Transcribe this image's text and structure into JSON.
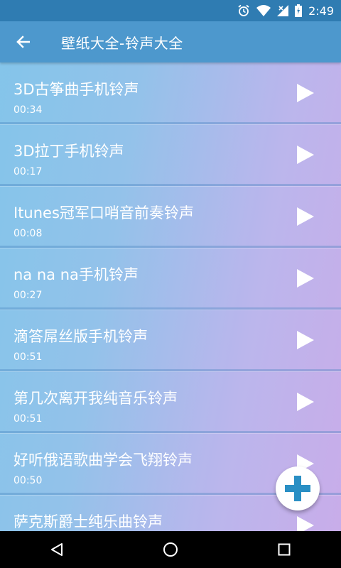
{
  "status_bar": {
    "time": "2:49",
    "icons": [
      "alarm-icon",
      "wifi-icon",
      "signal-icon",
      "battery-icon"
    ]
  },
  "app_bar": {
    "title": "壁纸大全-铃声大全",
    "back_icon": "arrow-left-icon"
  },
  "ringtones": [
    {
      "title": "3D古筝曲手机铃声",
      "duration": "00:34"
    },
    {
      "title": "3D拉丁手机铃声",
      "duration": "00:17"
    },
    {
      "title": "Itunes冠军口哨音前奏铃声",
      "duration": "00:08"
    },
    {
      "title": "na na na手机铃声",
      "duration": "00:27"
    },
    {
      "title": "滴答屌丝版手机铃声",
      "duration": "00:51"
    },
    {
      "title": "第几次离开我纯音乐铃声",
      "duration": "00:51"
    },
    {
      "title": "好听俄语歌曲学会飞翔铃声",
      "duration": "00:50"
    },
    {
      "title": "萨克斯爵士纯乐曲铃声",
      "duration": ""
    }
  ],
  "fab": {
    "icon": "plus-icon"
  },
  "nav_bar": {
    "icons": [
      "back-triangle-icon",
      "home-circle-icon",
      "recents-square-icon"
    ]
  },
  "colors": {
    "status_bar": "#2f7cb2",
    "app_bar": "#4d98cd",
    "fab_plus": "#2a8fc4",
    "nav_bar": "#000000"
  }
}
